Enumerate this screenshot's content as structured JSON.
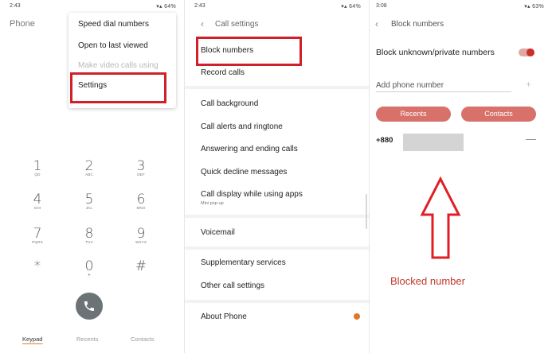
{
  "panel1": {
    "status": {
      "time": "2:43",
      "right": "64%"
    },
    "title": "Phone",
    "menu": {
      "items": [
        {
          "label": "Speed dial numbers"
        },
        {
          "label": "Open to last viewed"
        },
        {
          "label": "Make video calls using",
          "disabled": true
        },
        {
          "label": "Settings",
          "highlighted": true
        }
      ]
    },
    "keypad": [
      {
        "num": "1",
        "letters": "QD"
      },
      {
        "num": "2",
        "letters": "ABC"
      },
      {
        "num": "3",
        "letters": "DEF"
      },
      {
        "num": "4",
        "letters": "GHI"
      },
      {
        "num": "5",
        "letters": "JKL"
      },
      {
        "num": "6",
        "letters": "MNO"
      },
      {
        "num": "7",
        "letters": "PQRS"
      },
      {
        "num": "8",
        "letters": "TUV"
      },
      {
        "num": "9",
        "letters": "WXYZ"
      },
      {
        "num": "*",
        "letters": ""
      },
      {
        "num": "0",
        "letters": "+"
      },
      {
        "num": "#",
        "letters": ""
      }
    ],
    "tabs": [
      {
        "label": "Keypad",
        "active": true
      },
      {
        "label": "Recents"
      },
      {
        "label": "Contacts"
      }
    ]
  },
  "panel2": {
    "status": {
      "time": "2:43",
      "right": "64%"
    },
    "back_icon": "chevron-left-icon",
    "title": "Call settings",
    "items": [
      {
        "label": "Block numbers",
        "highlighted": true
      },
      {
        "label": "Record calls"
      },
      {
        "label": "Call background"
      },
      {
        "label": "Call alerts and ringtone"
      },
      {
        "label": "Answering and ending calls"
      },
      {
        "label": "Quick decline messages"
      },
      {
        "label": "Call display while using apps",
        "sub": "Mini pop-up"
      },
      {
        "label": "Voicemail"
      },
      {
        "label": "Supplementary services"
      },
      {
        "label": "Other call settings"
      },
      {
        "label": "About Phone"
      }
    ]
  },
  "panel3": {
    "status": {
      "time": "3:08",
      "right": "63%"
    },
    "back_icon": "chevron-left-icon",
    "title": "Block numbers",
    "block_unknown_label": "Block unknown/private numbers",
    "block_unknown_on": true,
    "add_placeholder": "Add phone number",
    "buttons": {
      "recents": "Recents",
      "contacts": "Contacts"
    },
    "blocked_prefix": "+880",
    "caption": "Blocked number"
  },
  "colors": {
    "highlight": "#d0202a",
    "accent": "#d8716a",
    "caption": "#c0392b"
  }
}
